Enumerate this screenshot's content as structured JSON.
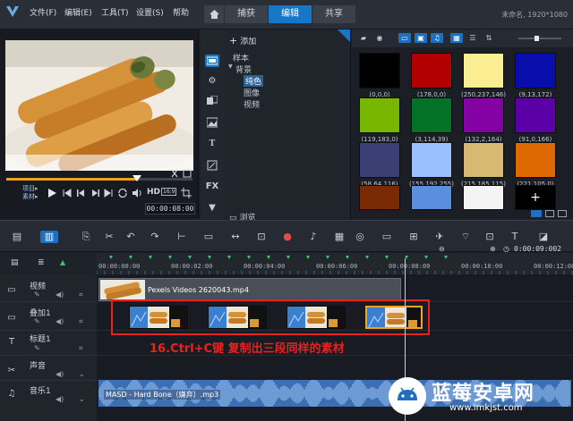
{
  "menubar": {
    "items": [
      "文件(F)",
      "编辑(E)",
      "工具(T)",
      "设置(S)",
      "帮助"
    ],
    "tabs": [
      "捕获",
      "编辑",
      "共享"
    ],
    "active_tab": "编辑",
    "project_info": "未命名, 1920*1080"
  },
  "player": {
    "mode_labels": [
      "项目▸",
      "素材▸"
    ],
    "timecode": "00:00:08:00",
    "controls": [
      "play-icon",
      "go-start-icon",
      "prev-frame-icon",
      "next-frame-icon",
      "go-end-icon",
      "repeat-icon",
      "volume-icon",
      "hd-label-icon",
      "aspect-icon",
      "crop-icon"
    ],
    "hd_label": "HD",
    "aspect_label": "16:9"
  },
  "library": {
    "add_label": "添加",
    "tree": [
      "样本",
      "背景",
      "纯色",
      "图像",
      "视频"
    ],
    "selected_tree_item": "纯色",
    "browse_label": "浏览",
    "swatches": [
      {
        "label": "(0,0,0)",
        "color": "#000000"
      },
      {
        "label": "(178,0,0)",
        "color": "#b20000"
      },
      {
        "label": "(250,237,146)",
        "color": "#faed92"
      },
      {
        "label": "(9,13,172)",
        "color": "#090dac"
      },
      {
        "label": "(119,183,0)",
        "color": "#77b700"
      },
      {
        "label": "(3,114,39)",
        "color": "#037227"
      },
      {
        "label": "(132,2,164)",
        "color": "#8402a4"
      },
      {
        "label": "(91,0,166)",
        "color": "#5b00a6"
      },
      {
        "label": "(58,64,116)",
        "color": "#3a4074"
      },
      {
        "label": "(155,192,255)",
        "color": "#9bc0ff"
      },
      {
        "label": "(215,185,115)",
        "color": "#d7b973"
      },
      {
        "label": "(221,105,0)",
        "color": "#dd6900"
      },
      {
        "label": "",
        "color": "#7a2a05"
      },
      {
        "label": "",
        "color": "#5a8fe0"
      },
      {
        "label": "",
        "color": "#f4f4f4"
      },
      {
        "label": "+",
        "color": "#000000"
      }
    ]
  },
  "timeline": {
    "ruler_labels": [
      "00:00:00:00",
      "00:00:02:00",
      "00:00:04:00",
      "00:00:06:00",
      "00:00:08:00",
      "00:00:10:00",
      "00:00:12:00"
    ],
    "zoom_timecode": "0:00:09:002",
    "tracks": [
      "视频",
      "叠加1",
      "标题1",
      "声音",
      "音乐1"
    ],
    "video_clip_name": "Pexels Videos 2620043.mp4",
    "audio_clip_name": "MASD - Hard Bone（嫌弃）.mp3",
    "annotation": "16.Ctrl+C键 复制出三段同样的素材"
  },
  "watermark": {
    "title": "蓝莓安卓网",
    "url": "www.lmkjst.com"
  }
}
